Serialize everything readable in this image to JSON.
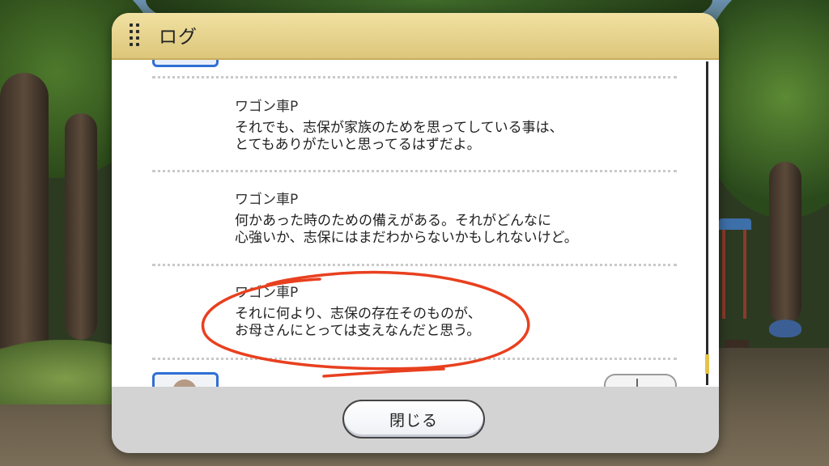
{
  "dialog": {
    "title": "ログ",
    "close_label": "閉じる"
  },
  "log": {
    "entries": [
      {
        "speaker": "ワゴン車P",
        "lines": [
          "それでも、志保が家族のためを思ってしている事は、",
          "とてもありがたいと思ってるはずだよ。"
        ]
      },
      {
        "speaker": "ワゴン車P",
        "lines": [
          "何かあった時のための備えがある。それがどんなに",
          "心強いか、志保にはまだわからないかもしれないけど。"
        ]
      },
      {
        "speaker": "ワゴン車P",
        "lines": [
          "それに何より、志保の存在そのものが、",
          "お母さんにとっては支えなんだと思う。"
        ]
      }
    ]
  },
  "colors": {
    "header_gold": "#dcc67a",
    "avatar_border_blue": "#2f6fd4",
    "scroll_thumb": "#e4c24a",
    "annotation_red": "#e8401f"
  },
  "icons": {
    "header": "grip-dots-icon",
    "voice": "voice-play-icon"
  }
}
